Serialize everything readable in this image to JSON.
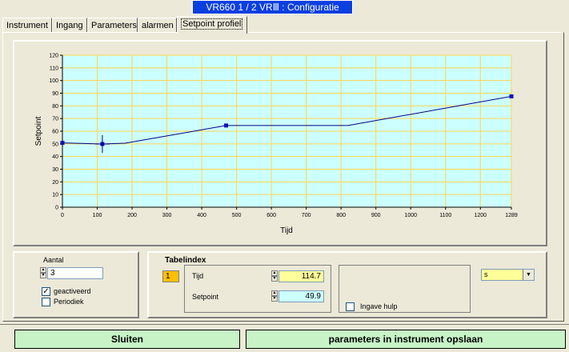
{
  "window": {
    "title": "VR660 1 / 2 VRⅢ  : Configuratie"
  },
  "tabs": [
    {
      "label": "Instrument"
    },
    {
      "label": "Ingang"
    },
    {
      "label": "Parameters"
    },
    {
      "label": "alarmen"
    },
    {
      "label": "Setpoint profiel",
      "active": true
    }
  ],
  "colors": {
    "plot_bg": "#ccffff",
    "grid": "#ffd34d",
    "line": "#000080",
    "button_bg": "#c7f3c7",
    "index_bg": "#ffc000",
    "tijd_bg": "#ffff99",
    "setpoint_bg": "#ccffff",
    "titlebar": "#0a3fe0"
  },
  "chart_data": {
    "type": "line",
    "xlabel": "Tijd",
    "ylabel": "Setpoint",
    "xlim": [
      0,
      1289
    ],
    "ylim": [
      0,
      120
    ],
    "x_ticks": [
      "0",
      "100",
      "200",
      "300",
      "400",
      "500",
      "600",
      "700",
      "800",
      "900",
      "1000",
      "1100",
      "1200",
      "1289"
    ],
    "x_tick_values": [
      0,
      100,
      200,
      300,
      400,
      500,
      600,
      700,
      800,
      900,
      1000,
      1100,
      1200,
      1289
    ],
    "y_ticks": [
      "0",
      "10",
      "20",
      "30",
      "40",
      "50",
      "60",
      "70",
      "80",
      "90",
      "100",
      "110",
      "120"
    ],
    "y_tick_values": [
      0,
      10,
      20,
      30,
      40,
      50,
      60,
      70,
      80,
      90,
      100,
      110,
      120
    ],
    "grid": true,
    "series": [
      {
        "x": [
          0,
          114.7,
          180,
          470,
          820,
          1289
        ],
        "y": [
          50.8,
          49.9,
          50.5,
          64.5,
          64.5,
          87.5
        ]
      }
    ],
    "markers_x": [
      0,
      114.7,
      470,
      1289
    ],
    "markers_y": [
      50.8,
      49.9,
      64.5,
      87.5
    ],
    "cursor": {
      "x": 114.7,
      "y": 49.9
    }
  },
  "aantal": {
    "label": "Aantal",
    "value": "3"
  },
  "checkboxes": [
    {
      "label": "geactiveerd",
      "checked": true,
      "mark": "✓"
    },
    {
      "label": "Periodiek",
      "checked": false,
      "mark": ""
    }
  ],
  "tabelindex": {
    "title": "Tabelindex",
    "index_value": "1",
    "tijd": {
      "label": "Tijd",
      "value": "114.7"
    },
    "setpoint": {
      "label": "Setpoint",
      "value": "49.9"
    },
    "ingave_hulp": {
      "label": "Ingave hulp",
      "checked": false
    }
  },
  "unit_select": {
    "value": "s",
    "arrow": "▼"
  },
  "spin_glyphs": {
    "up": "▲",
    "down": "▼"
  },
  "buttons": {
    "close": "Sluiten",
    "save": "parameters in instrument opslaan"
  }
}
